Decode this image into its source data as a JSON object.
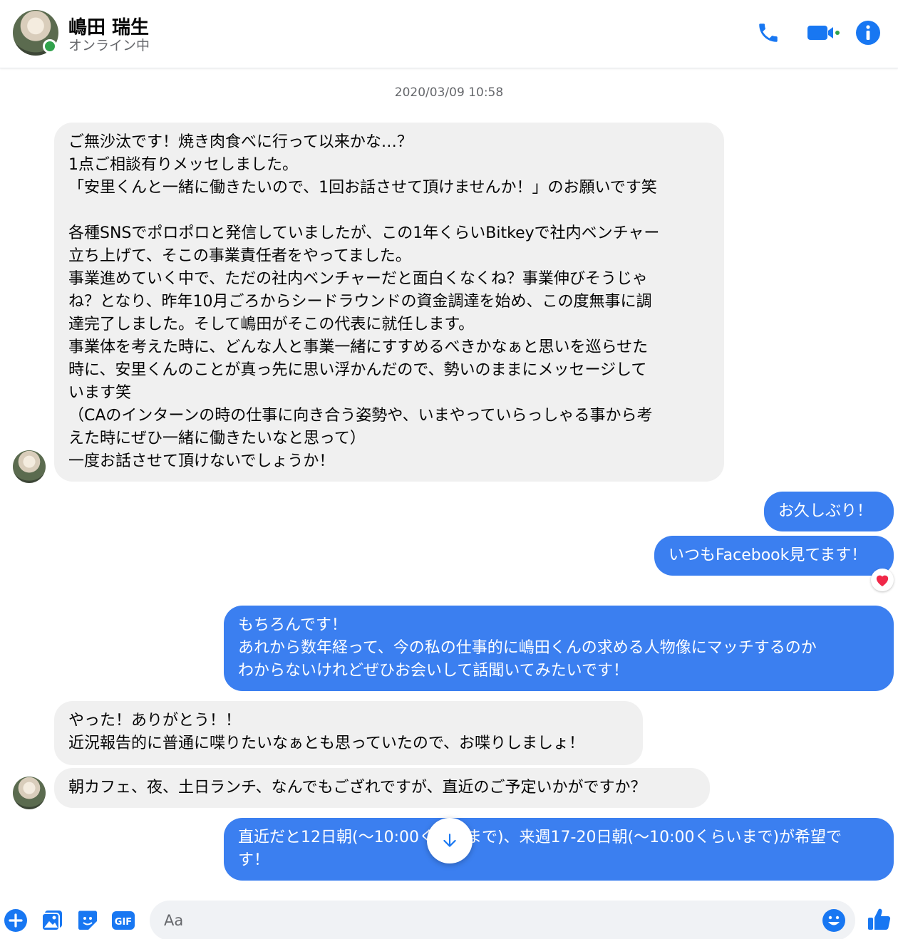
{
  "header": {
    "name": "嶋田 瑞生",
    "status": "オンライン中",
    "icons": [
      "phone-icon",
      "video-camera-icon",
      "info-icon"
    ],
    "accent_color": "#1877f2",
    "online_color": "#31a24c"
  },
  "conversation": {
    "timestamp": "2020/03/09 10:58",
    "messages": [
      {
        "from": "contact",
        "text": "ご無沙汰です！焼き肉食べに行って以来かな…？\n1点ご相談有りメッセしました。\n「安里くんと一緒に働きたいので、1回お話させて頂けませんか！」のお願いです笑\n\n各種SNSでポロポロと発信していましたが、この1年くらいBitkeyで社内ベンチャー\n立ち上げて、そこの事業責任者をやってました。\n事業進めていく中で、ただの社内ベンチャーだと面白くなくね？事業伸びそうじゃ\nね？となり、昨年10月ごろからシードラウンドの資金調達を始め、この度無事に調\n達完了しました。そして嶋田がそこの代表に就任します。\n事業体を考えた時に、どんな人と事業一緒にすすめるべきかなぁと思いを巡らせた\n時に、安里くんのことが真っ先に思い浮かんだので、勢いのままにメッセージして\nいます笑\n（CAのインターンの時の仕事に向き合う姿勢や、いまやっていらっしゃる事から考\nえた時にぜひ一緒に働きたいなと思って）\n一度お話させて頂けないでしょうか！"
      },
      {
        "from": "me",
        "text": "お久しぶり！"
      },
      {
        "from": "me",
        "text": "いつもFacebook見てます！",
        "reaction": "heart"
      },
      {
        "from": "me",
        "text": "もちろんです！\nあれから数年経って、今の私の仕事的に嶋田くんの求める人物像にマッチするのか\nわからないけれどぜひお会いして話聞いてみたいです！"
      },
      {
        "from": "contact",
        "text": "やった！ありがとう！！\n近況報告的に普通に喋りたいなぁとも思っていたので、お喋りしましょ！"
      },
      {
        "from": "contact",
        "text": "朝カフェ、夜、土日ランチ、なんでもござれですが、直近のご予定いかがですか？"
      },
      {
        "from": "me",
        "text": "直近だと12日朝(〜10:00くらいまで)、来週17-20日朝(〜10:00くらいまで)が希望で\nす！"
      }
    ],
    "outgoing_color": "#3b7ff0",
    "incoming_color": "#f0f0f0"
  },
  "composer": {
    "placeholder": "Aa",
    "icons": [
      "plus-icon",
      "image-icon",
      "sticker-icon",
      "gif-icon",
      "emoji-icon",
      "thumbs-up-icon"
    ]
  }
}
